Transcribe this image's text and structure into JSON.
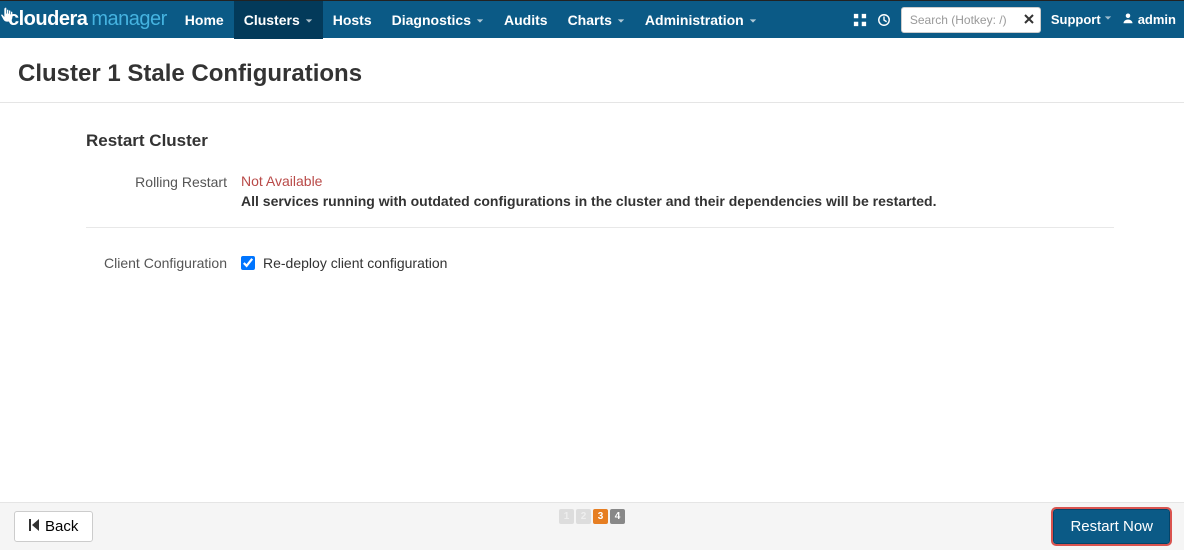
{
  "brand": {
    "part1": "cloudera",
    "part2": "manager"
  },
  "nav": {
    "home": "Home",
    "clusters": "Clusters",
    "hosts": "Hosts",
    "diagnostics": "Diagnostics",
    "audits": "Audits",
    "charts": "Charts",
    "administration": "Administration"
  },
  "search": {
    "placeholder": "Search (Hotkey: /)"
  },
  "support": "Support",
  "user": "admin",
  "page": {
    "title": "Cluster 1 Stale Configurations",
    "section_title": "Restart Cluster",
    "rolling_label": "Rolling Restart",
    "rolling_na": "Not Available",
    "rolling_desc": "All services running with outdated configurations in the cluster and their dependencies will be restarted.",
    "client_label": "Client Configuration",
    "client_checkbox": "Re-deploy client configuration"
  },
  "footer": {
    "back": "Back",
    "restart": "Restart Now",
    "steps": [
      "1",
      "2",
      "3",
      "4"
    ]
  }
}
